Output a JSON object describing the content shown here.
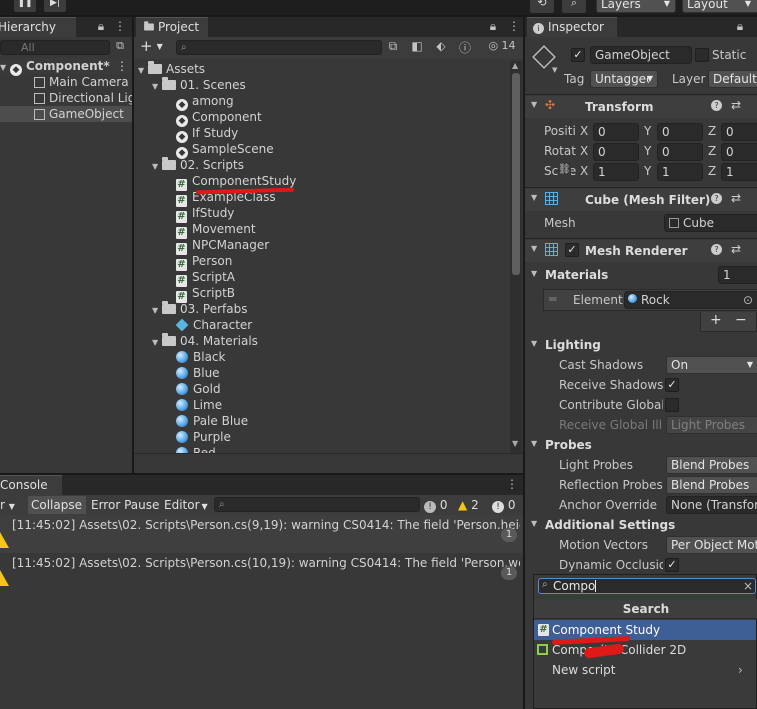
{
  "hierarchy": {
    "tab": "Hierarchy",
    "search_placeholder": "All",
    "scene": "Component*",
    "items": [
      "Main Camera",
      "Directional Light",
      "GameObject"
    ]
  },
  "project": {
    "tab": "Project",
    "add_label": "+",
    "visible_count": "14",
    "tree": [
      {
        "text": "Assets",
        "kind": "folder",
        "depth": 0
      },
      {
        "text": "01. Scenes",
        "kind": "folder",
        "depth": 1
      },
      {
        "text": "among",
        "kind": "scene",
        "depth": 2
      },
      {
        "text": "Component",
        "kind": "scene",
        "depth": 2
      },
      {
        "text": "If Study",
        "kind": "scene",
        "depth": 2
      },
      {
        "text": "SampleScene",
        "kind": "scene",
        "depth": 2
      },
      {
        "text": "02. Scripts",
        "kind": "folder",
        "depth": 1
      },
      {
        "text": "ComponentStudy",
        "kind": "script",
        "depth": 2
      },
      {
        "text": "ExampleClass",
        "kind": "script",
        "depth": 2
      },
      {
        "text": "IfStudy",
        "kind": "script",
        "depth": 2
      },
      {
        "text": "Movement",
        "kind": "script",
        "depth": 2
      },
      {
        "text": "NPCManager",
        "kind": "script",
        "depth": 2
      },
      {
        "text": "Person",
        "kind": "script",
        "depth": 2
      },
      {
        "text": "ScriptA",
        "kind": "script",
        "depth": 2
      },
      {
        "text": "ScriptB",
        "kind": "script",
        "depth": 2
      },
      {
        "text": "03. Perfabs",
        "kind": "folder",
        "depth": 1
      },
      {
        "text": "Character",
        "kind": "prefab",
        "depth": 2
      },
      {
        "text": "04. Materials",
        "kind": "folder",
        "depth": 1
      },
      {
        "text": "Black",
        "kind": "material",
        "depth": 2
      },
      {
        "text": "Blue",
        "kind": "material",
        "depth": 2
      },
      {
        "text": "Gold",
        "kind": "material",
        "depth": 2
      },
      {
        "text": "Lime",
        "kind": "material",
        "depth": 2
      },
      {
        "text": "Pale Blue",
        "kind": "material",
        "depth": 2
      },
      {
        "text": "Purple",
        "kind": "material",
        "depth": 2
      },
      {
        "text": "Red",
        "kind": "material",
        "depth": 2
      }
    ]
  },
  "toolbar": {
    "layers": "Layers",
    "layout": "Layout"
  },
  "console": {
    "tab": "Console",
    "clear_suffix": "r",
    "collapse": "Collapse",
    "error_pause": "Error Pause",
    "editor": "Editor",
    "counts": {
      "log": "0",
      "warn": "2",
      "error": "0"
    },
    "messages": [
      {
        "text": "[11:45:02] Assets\\02. Scripts\\Person.cs(9,19): warning CS0414: The field 'Person.height' is assigned but its value is never used",
        "count": "1"
      },
      {
        "text": "[11:45:02] Assets\\02. Scripts\\Person.cs(10,19): warning CS0414: The field 'Person.weight' is assigned but its value is never used",
        "count": "1"
      }
    ]
  },
  "inspector": {
    "tab": "Inspector",
    "object_name": "GameObject",
    "static_label": "Static",
    "tag_label": "Tag",
    "tag_value": "Untagged",
    "layer_label": "Layer",
    "layer_value": "Default",
    "transform": {
      "title": "Transform",
      "rows": [
        {
          "label": "Position",
          "x": "0",
          "y": "0",
          "z": "0"
        },
        {
          "label": "Rotation",
          "x": "0",
          "y": "0",
          "z": "0"
        },
        {
          "label": "Scale",
          "x": "1",
          "y": "1",
          "z": "1"
        }
      ]
    },
    "mesh_filter": {
      "title": "Cube (Mesh Filter)",
      "mesh_label": "Mesh",
      "mesh_value": "Cube"
    },
    "mesh_renderer": {
      "title": "Mesh Renderer",
      "materials_label": "Materials",
      "materials_count": "1",
      "element_label": "Element",
      "element_value": "Rock",
      "lighting": "Lighting",
      "cast_shadows_label": "Cast Shadows",
      "cast_shadows_value": "On",
      "receive_shadows_label": "Receive Shadows",
      "contribute_gi_label": "Contribute Global Illumination",
      "receive_gi_label": "Receive Global Illumination",
      "receive_gi_value": "Light Probes",
      "probes": "Probes",
      "light_probes_label": "Light Probes",
      "light_probes_value": "Blend Probes",
      "reflection_probes_label": "Reflection Probes",
      "reflection_probes_value": "Blend Probes",
      "anchor_override_label": "Anchor Override",
      "anchor_override_value": "None (Transform)",
      "additional": "Additional Settings",
      "motion_vectors_label": "Motion Vectors",
      "motion_vectors_value": "Per Object Motion",
      "dynamic_occlusion_label": "Dynamic Occlusion"
    }
  },
  "add_component_popup": {
    "search_value": "Compo",
    "header": "Search",
    "results": [
      "Component Study",
      "Composite Collider 2D",
      "New script"
    ]
  }
}
